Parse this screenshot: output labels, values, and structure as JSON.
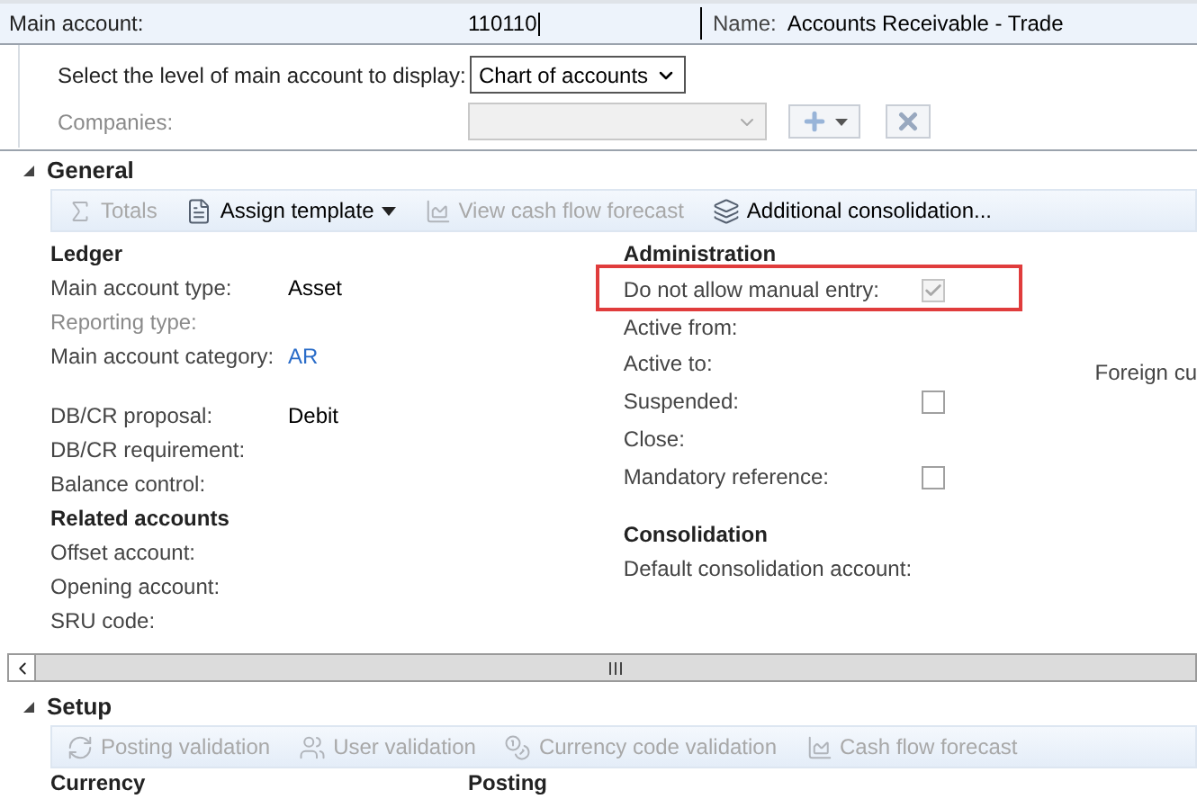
{
  "header": {
    "label": "Main account:",
    "value": "110110",
    "name_label": "Name:",
    "name_value": "Accounts Receivable - Trade"
  },
  "filter": {
    "level_label": "Select the level of main account to display:",
    "level_value": "Chart of accounts",
    "companies_label": "Companies:",
    "companies_disabled": true
  },
  "general": {
    "title": "General",
    "expanded": true,
    "toolbar": [
      {
        "label": "Totals",
        "disabled": true,
        "kind": "sigma",
        "menu": false
      },
      {
        "label": "Assign template",
        "disabled": false,
        "kind": "template",
        "menu": true
      },
      {
        "label": "View cash flow forecast",
        "disabled": true,
        "kind": "chart",
        "menu": false
      },
      {
        "label": "Additional consolidation...",
        "disabled": false,
        "kind": "consolidation",
        "menu": false
      }
    ],
    "ledger": {
      "title": "Ledger",
      "groups": [
        [
          {
            "label": "Main account type:",
            "value": "Asset",
            "kind": "text",
            "disabled": false
          },
          {
            "label": "Reporting type:",
            "disabled": true
          },
          {
            "label": "Main account category:",
            "value": "AR",
            "kind": "link",
            "disabled": false
          }
        ],
        [
          {
            "label": "DB/CR proposal:",
            "value": "Debit",
            "kind": "text",
            "disabled": false
          },
          {
            "label": "DB/CR requirement:",
            "disabled": false
          },
          {
            "label": "Balance control:",
            "disabled": false
          }
        ]
      ]
    },
    "related": {
      "title": "Related accounts",
      "fields": [
        {
          "label": "Offset account:"
        },
        {
          "label": "Opening account:"
        },
        {
          "label": "SRU code:"
        }
      ]
    },
    "administration": {
      "title": "Administration",
      "fields": [
        {
          "label": "Do not allow manual entry:",
          "kind": "checkbox",
          "checked": true,
          "disabled": true,
          "highlighted": true
        },
        {
          "label": "Active from:",
          "kind": "text",
          "highlighted": false
        },
        {
          "label": "Active to:",
          "kind": "text",
          "highlighted": false
        },
        {
          "label": "Suspended:",
          "kind": "checkbox",
          "checked": false,
          "disabled": false,
          "highlighted": false
        },
        {
          "label": "Close:",
          "kind": "text",
          "highlighted": false
        },
        {
          "label": "Mandatory reference:",
          "kind": "checkbox",
          "checked": false,
          "disabled": false,
          "highlighted": false
        }
      ]
    },
    "consolidation": {
      "title": "Consolidation",
      "fields": [
        {
          "label": "Default consolidation account:"
        }
      ]
    },
    "column_3": {
      "label": "Foreign cu"
    }
  },
  "setup": {
    "title": "Setup",
    "expanded": true,
    "toolbar": [
      {
        "label": "Posting validation",
        "disabled": true,
        "kind": "arrows",
        "menu": false
      },
      {
        "label": "User validation",
        "disabled": true,
        "kind": "users",
        "menu": false
      },
      {
        "label": "Currency code validation",
        "disabled": true,
        "kind": "currency",
        "menu": false
      },
      {
        "label": "Cash flow forecast",
        "disabled": true,
        "kind": "chart",
        "menu": false
      }
    ],
    "groups": [
      {
        "title": "Currency"
      },
      {
        "title": "Posting"
      }
    ]
  }
}
